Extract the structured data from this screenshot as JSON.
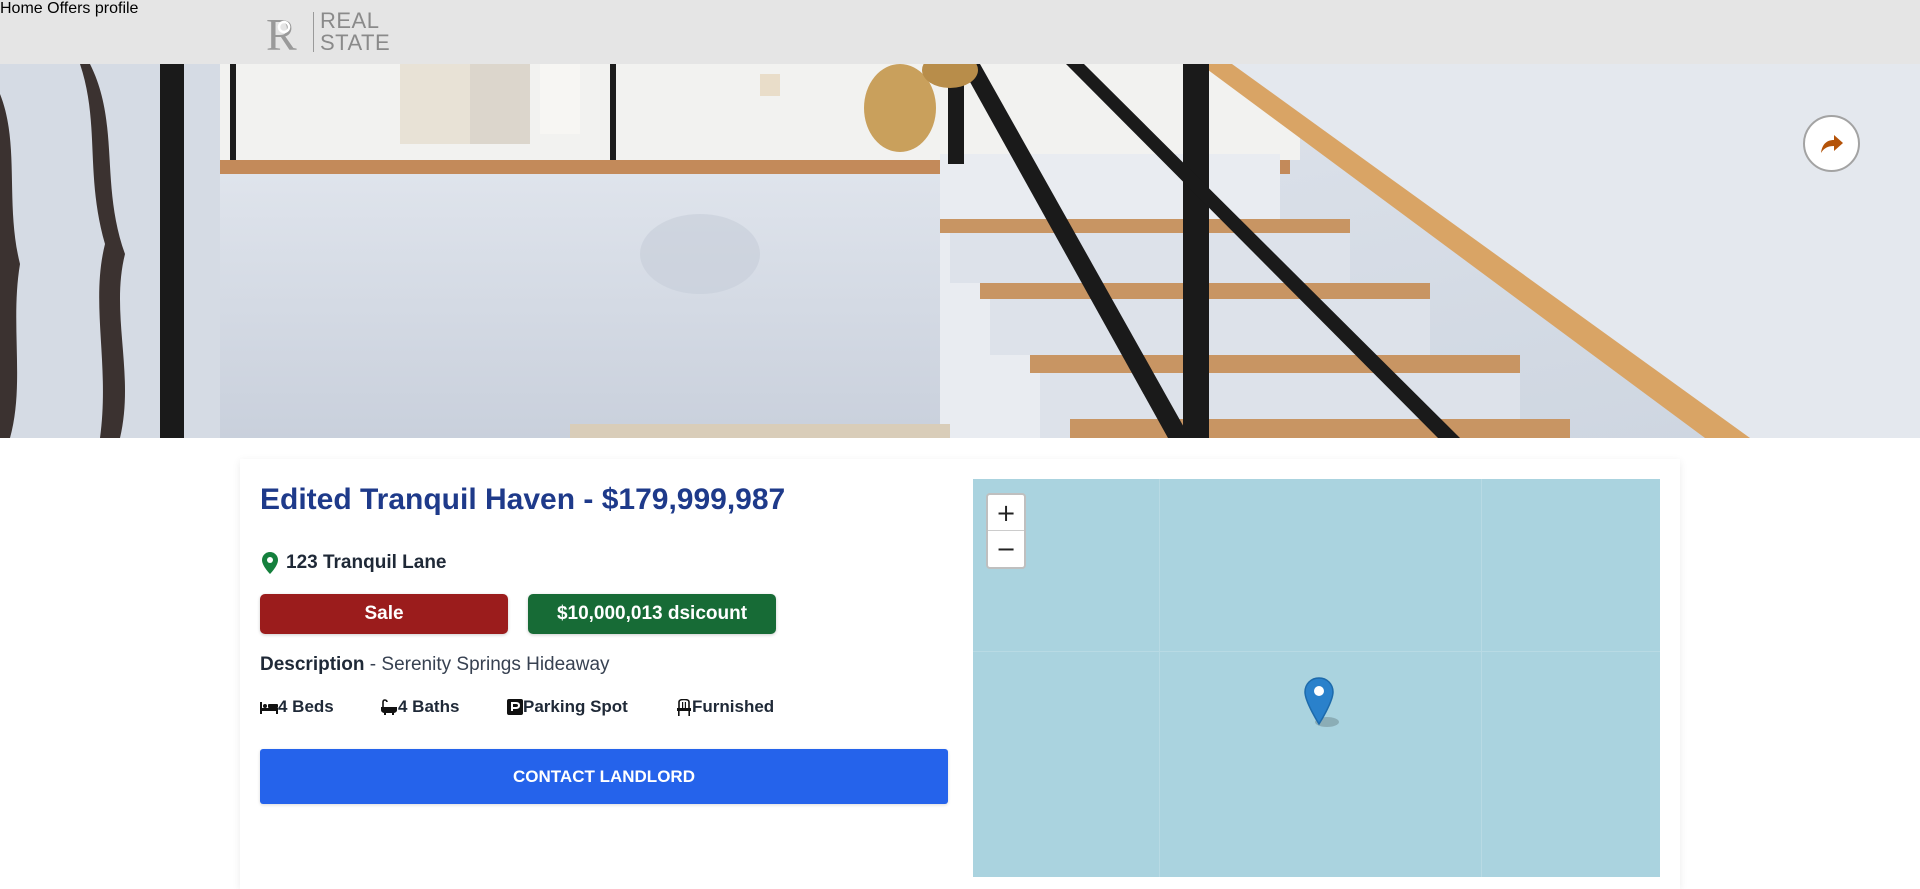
{
  "header": {
    "logo": {
      "line1": "REAL",
      "line2": "STATE"
    },
    "nav": [
      {
        "label": "Home"
      },
      {
        "label": "Offers"
      },
      {
        "label": "profile"
      }
    ]
  },
  "hero": {
    "share_icon": "share-arrow-icon"
  },
  "listing": {
    "title": "Edited Tranquil Haven - $179,999,987",
    "address": "123 Tranquil Lane",
    "type_badge": "Sale",
    "discount_badge": "$10,000,013 dsicount",
    "description_label": "Description",
    "description_sep": " - ",
    "description": "Serenity Springs Hideaway",
    "features": [
      {
        "icon": "bed-icon",
        "label": "4 Beds"
      },
      {
        "icon": "bath-icon",
        "label": "4 Baths"
      },
      {
        "icon": "parking-icon",
        "label": "Parking Spot"
      },
      {
        "icon": "chair-icon",
        "label": "Furnished"
      }
    ],
    "contact_button": "CONTACT LANDLORD"
  },
  "map": {
    "zoom_in": "+",
    "zoom_out": "−"
  },
  "colors": {
    "title": "#1e3a8a",
    "sale": "#9b1c1c",
    "discount": "#176b36",
    "contact": "#2563eb",
    "pin": "#15803d",
    "map_water": "#aad3df",
    "share_icon": "#b45309"
  }
}
